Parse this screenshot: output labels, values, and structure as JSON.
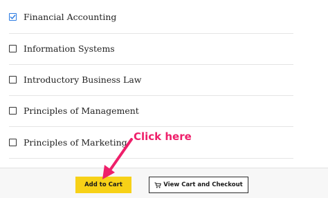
{
  "courses": [
    {
      "label": "Financial Accounting",
      "checked": true
    },
    {
      "label": "Information Systems",
      "checked": false
    },
    {
      "label": "Introductory Business Law",
      "checked": false
    },
    {
      "label": "Principles of Management",
      "checked": false
    },
    {
      "label": "Principles of Marketing",
      "checked": false
    }
  ],
  "actions": {
    "add_to_cart_label": "Add to Cart",
    "view_cart_label": "View Cart and Checkout"
  },
  "annotation": {
    "text": "Click here"
  },
  "colors": {
    "accent_yellow": "#f7d117",
    "annotation_pink": "#ee1f6a",
    "checkbox_checked_blue": "#2a7ae2"
  },
  "icons": {
    "cart": "cart-icon",
    "checkmark": "checkmark-icon",
    "arrow": "arrow-icon"
  }
}
